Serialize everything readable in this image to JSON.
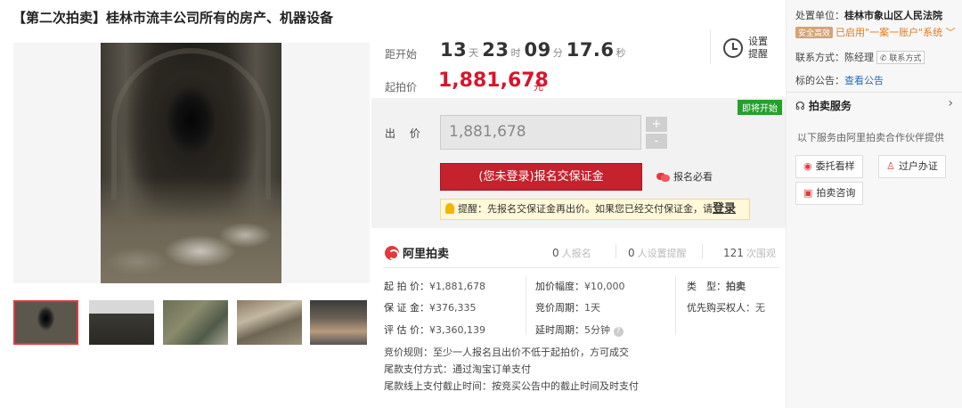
{
  "title": "【第二次拍卖】桂林市流丰公司所有的房产、机器设备",
  "countdown": {
    "label": "距开始",
    "days": "13",
    "days_unit": "天",
    "hours": "23",
    "hours_unit": "时",
    "minutes": "09",
    "minutes_unit": "分",
    "seconds": "17.6",
    "seconds_unit": "秒"
  },
  "reminder": {
    "label": "设置提醒"
  },
  "start_price": {
    "label": "起拍价",
    "value": "1,881,678",
    "unit": "元"
  },
  "bid": {
    "status_badge": "即将开始",
    "label": "出 价",
    "input_value": "1,881,678",
    "plus": "+",
    "minus": "-",
    "register_button": "(您未登录)报名交保证金",
    "must_read": "报名必看",
    "tip_text": "提醒：先报名交保证金再出价。如果您已经交付保证金，请",
    "tip_login": "登录"
  },
  "stats": {
    "brand": "阿里拍卖",
    "signups_count": "0",
    "signups_label": "人报名",
    "reminders_count": "0",
    "reminders_label": "人设置提醒",
    "views_count": "121",
    "views_label": "次围观"
  },
  "details": {
    "start_price": {
      "key": "起 拍 价：",
      "value": "¥1,881,678"
    },
    "deposit": {
      "key": "保 证 金：",
      "value": "¥376,335"
    },
    "appraisal": {
      "key": "评 估 价：",
      "value": "¥3,360,139"
    },
    "increment": {
      "key": "加价幅度：",
      "value": "¥10,000"
    },
    "cycle": {
      "key": "竞价周期：",
      "value": "1天"
    },
    "delay": {
      "key": "延时周期：",
      "value": "5分钟"
    },
    "type": {
      "key": "类　型：",
      "value": "拍卖"
    },
    "priority": {
      "key": "优先购买权人",
      "value": "：无"
    }
  },
  "rules": [
    "竞价规则：至少一人报名且出价不低于起拍价，方可成交",
    "尾款支付方式：通过淘宝订单支付",
    "尾款线上支付截止时间：按竞买公告中的截止时间及时支付"
  ],
  "sidebar": {
    "court_label": "处置单位：",
    "court_name": "桂林市象山区人民法院",
    "safe_badge": "安全高效",
    "safe_text": "已启用\"一案一账户\"系统",
    "contact_label": "联系方式：",
    "contact_name": "陈经理",
    "contact_button": "联系方式",
    "notice_label": "标的公告：",
    "notice_link": "查看公告",
    "service_title": "拍卖服务",
    "service_desc": "以下服务由阿里拍卖合作伙伴提供",
    "services": [
      "委托看样",
      "过户办证",
      "拍卖咨询"
    ]
  }
}
